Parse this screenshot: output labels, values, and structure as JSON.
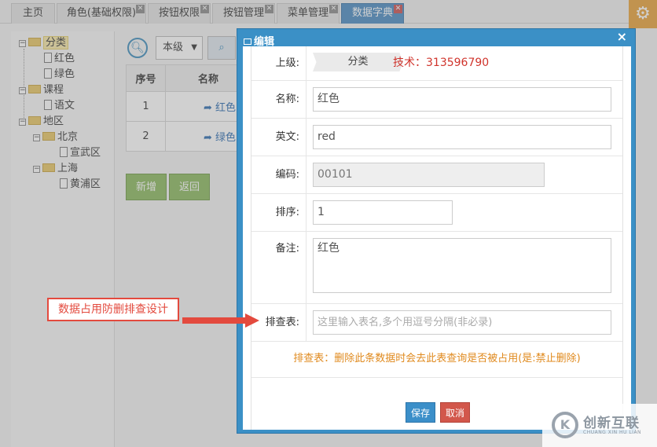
{
  "tabs": [
    {
      "label": "主页",
      "closable": false,
      "active": false
    },
    {
      "label": "角色(基础权限)",
      "closable": true,
      "active": false
    },
    {
      "label": "按钮权限",
      "closable": true,
      "active": false
    },
    {
      "label": "按钮管理",
      "closable": true,
      "active": false
    },
    {
      "label": "菜单管理",
      "closable": true,
      "active": false
    },
    {
      "label": "数据字典",
      "closable": true,
      "active": true
    }
  ],
  "tree": [
    {
      "label": "分类",
      "type": "folder",
      "expanded": true,
      "selected": true,
      "children": [
        {
          "label": "红色",
          "type": "file"
        },
        {
          "label": "绿色",
          "type": "file"
        }
      ]
    },
    {
      "label": "课程",
      "type": "folder",
      "expanded": true,
      "children": [
        {
          "label": "语文",
          "type": "file"
        }
      ]
    },
    {
      "label": "地区",
      "type": "folder",
      "expanded": true,
      "children": [
        {
          "label": "北京",
          "type": "folder",
          "expanded": true,
          "children": [
            {
              "label": "宣武区",
              "type": "file"
            }
          ]
        },
        {
          "label": "上海",
          "type": "folder",
          "expanded": true,
          "children": [
            {
              "label": "黄浦区",
              "type": "file"
            }
          ]
        }
      ]
    }
  ],
  "toolbar": {
    "level_select": "本级"
  },
  "grid": {
    "headers": [
      "序号",
      "名称"
    ],
    "rows": [
      {
        "index": "1",
        "name": "红色"
      },
      {
        "index": "2",
        "name": "绿色"
      }
    ]
  },
  "buttons": {
    "add": "新增",
    "back": "返回"
  },
  "modal": {
    "title": "编辑",
    "close": "×",
    "fields": {
      "parent": {
        "label": "上级:",
        "value": "分类"
      },
      "name": {
        "label": "名称:",
        "value": "红色"
      },
      "english": {
        "label": "英文:",
        "value": "red"
      },
      "code": {
        "label": "编码:",
        "value": "00101"
      },
      "order": {
        "label": "排序:",
        "value": "1"
      },
      "remark": {
        "label": "备注:",
        "value": "红色"
      },
      "check_table": {
        "label": "排查表:",
        "placeholder": "这里输入表名,多个用逗号分隔(非必录)"
      }
    },
    "tip": "排查表：删除此条数据时会去此表查询是否被占用(是:禁止删除)",
    "save": "保存",
    "cancel": "取消"
  },
  "watermark_text": "技术：313596790",
  "callout": "数据占用防删排查设计",
  "brand": {
    "name_cn": "创新互联",
    "name_en": "CHUANG XIN HU LIAN",
    "logo": "K"
  },
  "colors": {
    "accent": "#3b90c6",
    "danger": "#d2574b",
    "success": "#8bb95f",
    "warning": "#e08a1e",
    "callout": "#e34a3e"
  }
}
